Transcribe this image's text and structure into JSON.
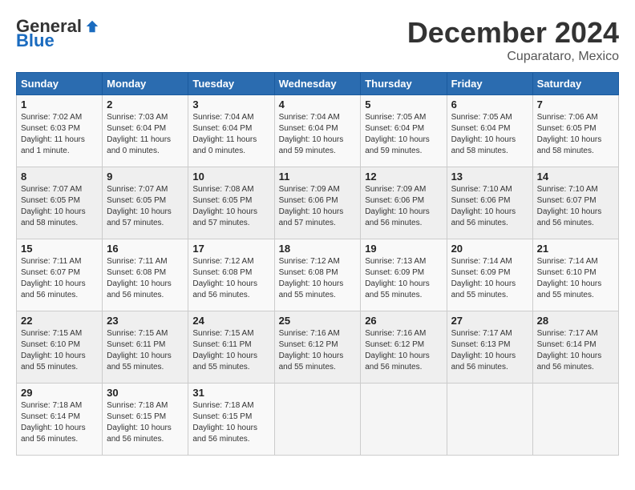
{
  "header": {
    "logo_general": "General",
    "logo_blue": "Blue",
    "month_title": "December 2024",
    "location": "Cuparataro, Mexico"
  },
  "weekdays": [
    "Sunday",
    "Monday",
    "Tuesday",
    "Wednesday",
    "Thursday",
    "Friday",
    "Saturday"
  ],
  "weeks": [
    [
      {
        "day": "1",
        "info": "Sunrise: 7:02 AM\nSunset: 6:03 PM\nDaylight: 11 hours\nand 1 minute."
      },
      {
        "day": "2",
        "info": "Sunrise: 7:03 AM\nSunset: 6:04 PM\nDaylight: 11 hours\nand 0 minutes."
      },
      {
        "day": "3",
        "info": "Sunrise: 7:04 AM\nSunset: 6:04 PM\nDaylight: 11 hours\nand 0 minutes."
      },
      {
        "day": "4",
        "info": "Sunrise: 7:04 AM\nSunset: 6:04 PM\nDaylight: 10 hours\nand 59 minutes."
      },
      {
        "day": "5",
        "info": "Sunrise: 7:05 AM\nSunset: 6:04 PM\nDaylight: 10 hours\nand 59 minutes."
      },
      {
        "day": "6",
        "info": "Sunrise: 7:05 AM\nSunset: 6:04 PM\nDaylight: 10 hours\nand 58 minutes."
      },
      {
        "day": "7",
        "info": "Sunrise: 7:06 AM\nSunset: 6:05 PM\nDaylight: 10 hours\nand 58 minutes."
      }
    ],
    [
      {
        "day": "8",
        "info": "Sunrise: 7:07 AM\nSunset: 6:05 PM\nDaylight: 10 hours\nand 58 minutes."
      },
      {
        "day": "9",
        "info": "Sunrise: 7:07 AM\nSunset: 6:05 PM\nDaylight: 10 hours\nand 57 minutes."
      },
      {
        "day": "10",
        "info": "Sunrise: 7:08 AM\nSunset: 6:05 PM\nDaylight: 10 hours\nand 57 minutes."
      },
      {
        "day": "11",
        "info": "Sunrise: 7:09 AM\nSunset: 6:06 PM\nDaylight: 10 hours\nand 57 minutes."
      },
      {
        "day": "12",
        "info": "Sunrise: 7:09 AM\nSunset: 6:06 PM\nDaylight: 10 hours\nand 56 minutes."
      },
      {
        "day": "13",
        "info": "Sunrise: 7:10 AM\nSunset: 6:06 PM\nDaylight: 10 hours\nand 56 minutes."
      },
      {
        "day": "14",
        "info": "Sunrise: 7:10 AM\nSunset: 6:07 PM\nDaylight: 10 hours\nand 56 minutes."
      }
    ],
    [
      {
        "day": "15",
        "info": "Sunrise: 7:11 AM\nSunset: 6:07 PM\nDaylight: 10 hours\nand 56 minutes."
      },
      {
        "day": "16",
        "info": "Sunrise: 7:11 AM\nSunset: 6:08 PM\nDaylight: 10 hours\nand 56 minutes."
      },
      {
        "day": "17",
        "info": "Sunrise: 7:12 AM\nSunset: 6:08 PM\nDaylight: 10 hours\nand 56 minutes."
      },
      {
        "day": "18",
        "info": "Sunrise: 7:12 AM\nSunset: 6:08 PM\nDaylight: 10 hours\nand 55 minutes."
      },
      {
        "day": "19",
        "info": "Sunrise: 7:13 AM\nSunset: 6:09 PM\nDaylight: 10 hours\nand 55 minutes."
      },
      {
        "day": "20",
        "info": "Sunrise: 7:14 AM\nSunset: 6:09 PM\nDaylight: 10 hours\nand 55 minutes."
      },
      {
        "day": "21",
        "info": "Sunrise: 7:14 AM\nSunset: 6:10 PM\nDaylight: 10 hours\nand 55 minutes."
      }
    ],
    [
      {
        "day": "22",
        "info": "Sunrise: 7:15 AM\nSunset: 6:10 PM\nDaylight: 10 hours\nand 55 minutes."
      },
      {
        "day": "23",
        "info": "Sunrise: 7:15 AM\nSunset: 6:11 PM\nDaylight: 10 hours\nand 55 minutes."
      },
      {
        "day": "24",
        "info": "Sunrise: 7:15 AM\nSunset: 6:11 PM\nDaylight: 10 hours\nand 55 minutes."
      },
      {
        "day": "25",
        "info": "Sunrise: 7:16 AM\nSunset: 6:12 PM\nDaylight: 10 hours\nand 55 minutes."
      },
      {
        "day": "26",
        "info": "Sunrise: 7:16 AM\nSunset: 6:12 PM\nDaylight: 10 hours\nand 56 minutes."
      },
      {
        "day": "27",
        "info": "Sunrise: 7:17 AM\nSunset: 6:13 PM\nDaylight: 10 hours\nand 56 minutes."
      },
      {
        "day": "28",
        "info": "Sunrise: 7:17 AM\nSunset: 6:14 PM\nDaylight: 10 hours\nand 56 minutes."
      }
    ],
    [
      {
        "day": "29",
        "info": "Sunrise: 7:18 AM\nSunset: 6:14 PM\nDaylight: 10 hours\nand 56 minutes."
      },
      {
        "day": "30",
        "info": "Sunrise: 7:18 AM\nSunset: 6:15 PM\nDaylight: 10 hours\nand 56 minutes."
      },
      {
        "day": "31",
        "info": "Sunrise: 7:18 AM\nSunset: 6:15 PM\nDaylight: 10 hours\nand 56 minutes."
      },
      null,
      null,
      null,
      null
    ]
  ]
}
